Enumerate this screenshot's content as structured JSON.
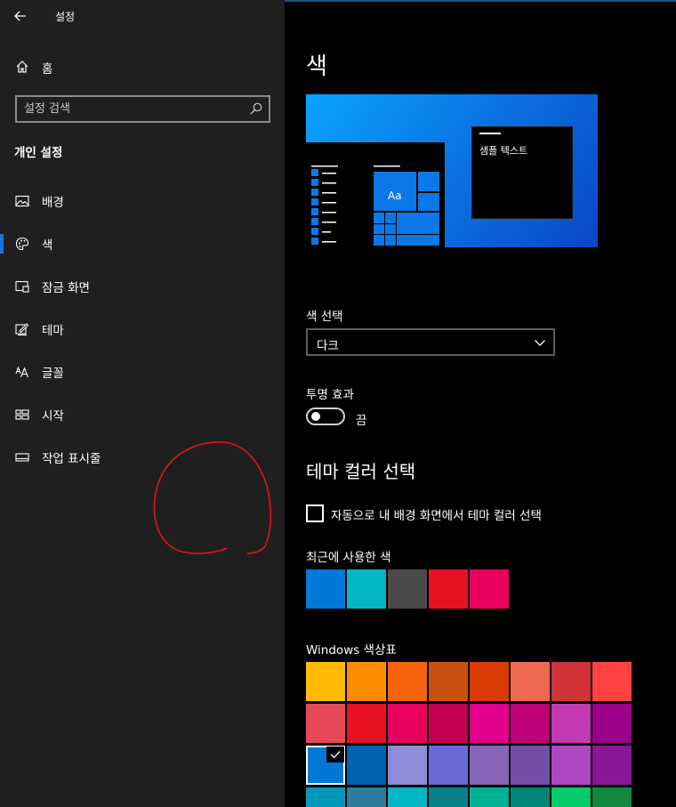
{
  "sidebar": {
    "app_title": "설정",
    "home_label": "홈",
    "search_placeholder": "설정 검색",
    "section_title": "개인 설정",
    "items": [
      {
        "label": "배경",
        "icon": "picture-icon"
      },
      {
        "label": "색",
        "icon": "palette-icon",
        "active": true
      },
      {
        "label": "잠금 화면",
        "icon": "lock-screen-icon"
      },
      {
        "label": "테마",
        "icon": "theme-icon"
      },
      {
        "label": "글꼴",
        "icon": "font-icon"
      },
      {
        "label": "시작",
        "icon": "start-icon"
      },
      {
        "label": "작업 표시줄",
        "icon": "taskbar-icon"
      }
    ]
  },
  "main": {
    "page_title": "색",
    "preview_text": "샘플 텍스트",
    "preview_tile_text": "Aa",
    "color_mode_label": "색 선택",
    "color_mode_value": "다크",
    "transparency_label": "투명 효과",
    "transparency_state": "끔",
    "accent_title": "테마 컬러 선택",
    "auto_accent_label": "자동으로 내 배경 화면에서 테마 컬러 선택",
    "recent_label": "최근에 사용한 색",
    "recent_colors": [
      "#0078d7",
      "#00b7c3",
      "#4c4a48",
      "#e81123",
      "#ea005e"
    ],
    "palette_label": "Windows 색상표",
    "palette_colors": [
      [
        "#ffb900",
        "#ff8c00",
        "#f7630c",
        "#ca5010",
        "#da3b01",
        "#ef6950",
        "#d13438",
        "#ff4343"
      ],
      [
        "#e74856",
        "#e81123",
        "#ea005e",
        "#c30052",
        "#e3008c",
        "#bf0077",
        "#c239b3",
        "#9a0089"
      ],
      [
        "#0078d7",
        "#0063b1",
        "#8e8cd8",
        "#6b69d6",
        "#8764b8",
        "#744da9",
        "#b146c2",
        "#881798"
      ],
      [
        "#0099bc",
        "#2d7d9a",
        "#00b7c3",
        "#038387",
        "#00b294",
        "#018574",
        "#00cc6a",
        "#10893e"
      ]
    ],
    "selected_palette_color": "#0078d7"
  },
  "colors": {
    "sidebar_bg": "#1f1f1f",
    "main_bg": "#000000",
    "accent": "#1a73d9",
    "annotation": "#e0141e"
  }
}
